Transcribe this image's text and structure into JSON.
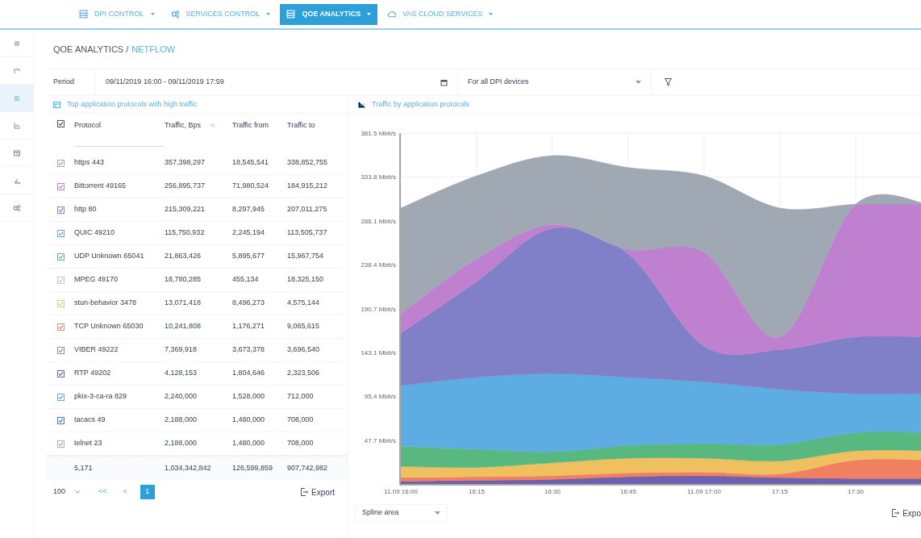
{
  "nav": [
    {
      "label": "DPI CONTROL",
      "selected": false
    },
    {
      "label": "SERVICES CONTROL",
      "selected": false
    },
    {
      "label": "QOE ANALYTICS",
      "selected": true
    },
    {
      "label": "VAS CLOUD SERVICES",
      "selected": false
    }
  ],
  "sidebar": [
    {
      "selected": false
    },
    {
      "selected": false
    },
    {
      "selected": true
    },
    {
      "selected": false
    },
    {
      "selected": false
    },
    {
      "selected": false
    },
    {
      "selected": false
    }
  ],
  "breadcrumb": {
    "section": "QOE ANALYTICS",
    "separator": "/",
    "page": "NETFLOW"
  },
  "period": {
    "label": "Period",
    "value": "09/11/2019 16:00 - 09/11/2019 17:59",
    "device": "For all DPI devices"
  },
  "table": {
    "title": "Top application protocols with high traffic",
    "all_checked": true,
    "columns": [
      "Protocol",
      "Traffic, Bps",
      "Traffic from",
      "Traffic to"
    ],
    "sort_mark": "=",
    "rows": [
      {
        "protocol": "https 443",
        "traffic": "357,398,297",
        "from": "18,545,541",
        "to": "338,852,755",
        "checked": true,
        "color": "#a0a8b4"
      },
      {
        "protocol": "Bittorrent 49165",
        "traffic": "256,895,737",
        "from": "71,980,524",
        "to": "184,915,212",
        "checked": true,
        "color": "#c080d0"
      },
      {
        "protocol": "http 80",
        "traffic": "215,309,221",
        "from": "8,297,945",
        "to": "207,011,275",
        "checked": true,
        "color": "#8080c8"
      },
      {
        "protocol": "QUIC 49210",
        "traffic": "115,750,932",
        "from": "2,245,194",
        "to": "113,505,737",
        "checked": true,
        "color": "#5dade2"
      },
      {
        "protocol": "UDP Unknown 65041",
        "traffic": "21,863,426",
        "from": "5,895,677",
        "to": "15,967,754",
        "checked": true,
        "color": "#58b880"
      },
      {
        "protocol": "MPEG 49170",
        "traffic": "18,780,285",
        "from": "455,134",
        "to": "18,325,150",
        "checked": true,
        "color": "#c8c8b0"
      },
      {
        "protocol": "stun-behavior 3478",
        "traffic": "13,071,418",
        "from": "8,496,273",
        "to": "4,575,144",
        "checked": true,
        "color": "#f0c080"
      },
      {
        "protocol": "TCP Unknown 65030",
        "traffic": "10,241,808",
        "from": "1,176,271",
        "to": "9,065,615",
        "checked": true,
        "color": "#f08060"
      },
      {
        "protocol": "VIBER 49222",
        "traffic": "7,369,918",
        "from": "3,673,378",
        "to": "3,696,540",
        "checked": true,
        "color": "#909090"
      },
      {
        "protocol": "RTP 49202",
        "traffic": "4,128,153",
        "from": "1,804,646",
        "to": "2,323,506",
        "checked": true,
        "color": "#7060b0"
      },
      {
        "protocol": "pkix-3-ca-ra 829",
        "traffic": "2,240,000",
        "from": "1,528,000",
        "to": "712,000",
        "checked": true,
        "color": "#5dade2"
      },
      {
        "protocol": "tacacs 49",
        "traffic": "2,188,000",
        "from": "1,480,000",
        "to": "708,000",
        "checked": true,
        "color": "#4080c0"
      },
      {
        "protocol": "telnet 23",
        "traffic": "2,188,000",
        "from": "1,480,000",
        "to": "708,000",
        "checked": true,
        "color": "#b0b0b0"
      }
    ],
    "totals": [
      "5,171",
      "1,034,342,842",
      "126,599,859",
      "907,742,982"
    ],
    "page_size": "100",
    "pager": [
      {
        "label": "<<",
        "selected": false
      },
      {
        "label": "<",
        "selected": false
      },
      {
        "label": "1",
        "selected": true
      }
    ],
    "export": "Export"
  },
  "chart": {
    "title": "Traffic by application protocols",
    "chart_type": "Spline area",
    "export": "Expo",
    "chart_data": {
      "type": "area",
      "stacked": true,
      "grid": true,
      "categories": [
        "11.09 16:00",
        "16:15",
        "16:30",
        "16:45",
        "11.09 17:00",
        "17:15",
        "17:30"
      ],
      "ylim": [
        0,
        381.5
      ],
      "yticks": [
        {
          "value": 47.7,
          "label": "47.7 Mbit/s"
        },
        {
          "value": 95.4,
          "label": "95.4 Mbit/s"
        },
        {
          "value": 143.1,
          "label": "143.1 Mbit/s"
        },
        {
          "value": 190.7,
          "label": "190.7 Mbit/s"
        },
        {
          "value": 238.4,
          "label": "238.4 Mbit/s"
        },
        {
          "value": 286.1,
          "label": "286.1 Mbit/s"
        },
        {
          "value": 333.8,
          "label": "333.8 Mbit/s"
        },
        {
          "value": 381.5,
          "label": "381.5 Mbit/s"
        }
      ],
      "series": [
        {
          "color": "#7060b0",
          "values": [
            3,
            4,
            5,
            8,
            9,
            7,
            6
          ]
        },
        {
          "color": "#f08060",
          "values": [
            4,
            4,
            4,
            4,
            4,
            4,
            20
          ]
        },
        {
          "color": "#f0c060",
          "values": [
            12,
            10,
            14,
            16,
            15,
            14,
            10
          ]
        },
        {
          "color": "#58b880",
          "values": [
            22,
            20,
            12,
            14,
            16,
            18,
            20
          ]
        },
        {
          "color": "#5dade2",
          "values": [
            66,
            78,
            85,
            74,
            67,
            60,
            42
          ]
        },
        {
          "color": "#8080c8",
          "values": [
            57,
            104,
            158,
            134,
            39,
            43,
            62
          ]
        },
        {
          "color": "#c080d0",
          "values": [
            21,
            25,
            4,
            5,
            102,
            14,
            144
          ]
        },
        {
          "color": "#a0a8b4",
          "values": [
            115,
            90,
            75,
            89,
            83,
            140,
            0
          ]
        }
      ]
    }
  }
}
